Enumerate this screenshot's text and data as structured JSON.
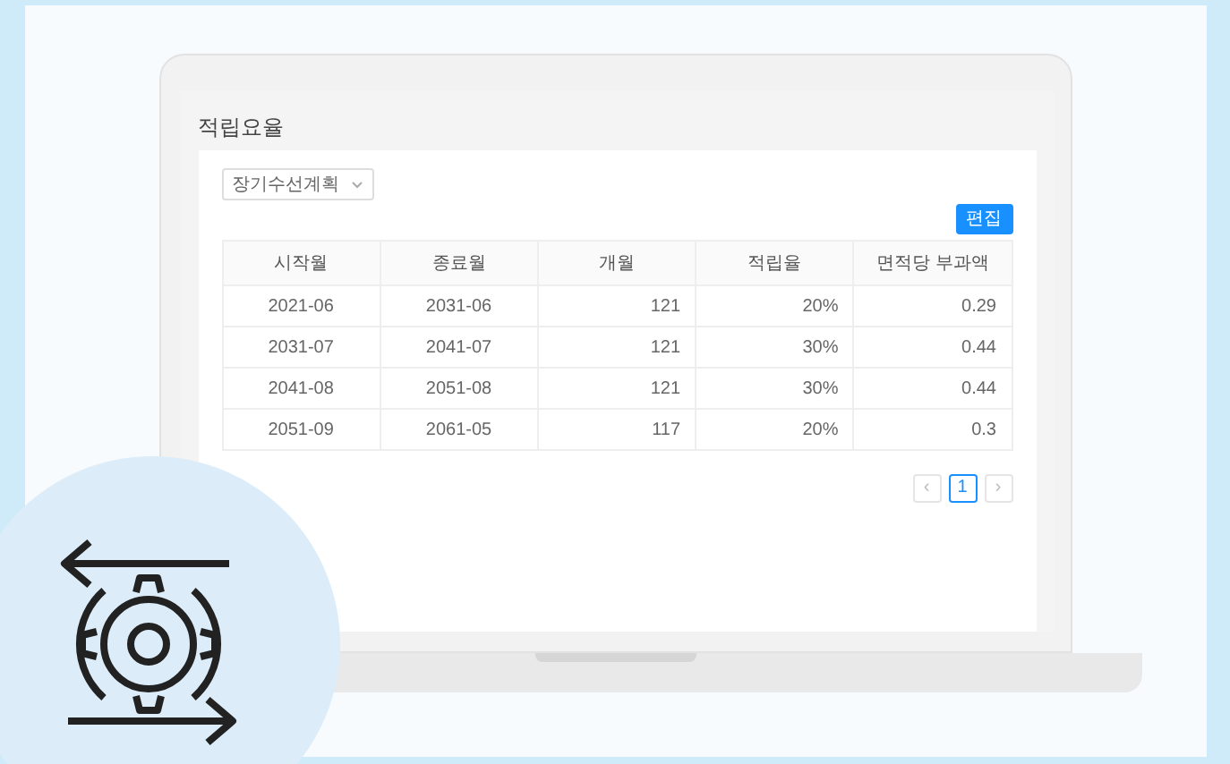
{
  "page": {
    "title": "적립요율"
  },
  "filter": {
    "value": "장기수선계획"
  },
  "edit_button": {
    "label": "편집"
  },
  "table": {
    "columns": [
      "시작월",
      "종료월",
      "개월",
      "적립율",
      "면적당 부과액"
    ],
    "rows": [
      [
        "2021-06",
        "2031-06",
        "121",
        "20%",
        "0.29"
      ],
      [
        "2031-07",
        "2041-07",
        "121",
        "30%",
        "0.44"
      ],
      [
        "2041-08",
        "2051-08",
        "121",
        "30%",
        "0.44"
      ],
      [
        "2051-09",
        "2061-05",
        "117",
        "20%",
        "0.3"
      ]
    ]
  },
  "pagination": {
    "prev": "‹",
    "pages": [
      {
        "label": "1",
        "selected": true
      }
    ],
    "next": "›"
  }
}
